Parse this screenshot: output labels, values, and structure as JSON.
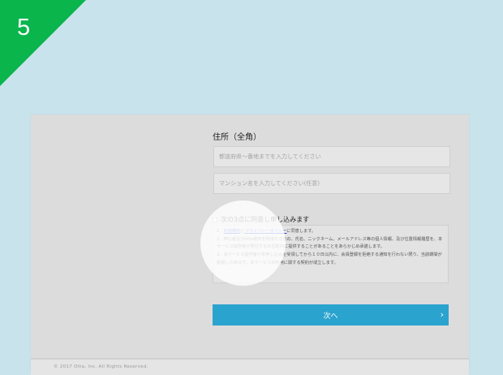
{
  "step": {
    "number": "5"
  },
  "form": {
    "address_title": "住所（全角）",
    "address_line1_placeholder": "都道府県〜番地までを入力してください",
    "address_line2_placeholder": "マンション名を入力してください(任意)",
    "agree_label": "次の3点に同意し申し込みます",
    "terms": {
      "item1_prefix": "1、",
      "item1_link1": "利用規約",
      "item1_sep": "と",
      "item1_link2": "プライバシーポリシー",
      "item1_suffix": "に同意します。",
      "item2": "2、申込者及びotta端末を所持する方の、氏名、ニックネーム、メールアドレス等の個人情報、及び位置情報履歴を、本サービス提供者が居住する市区町村に提供することがあることをあらかじめ承諾します。",
      "item3": "3、本サービス提供者が本申し込みを受領してから１０日以内に、会員登録を拒絶する通知を行わない限り、当該期間が経過した時点で、本サービスの利用に関する契約が成立します。"
    },
    "next_label": "次へ",
    "next_chevron": "›"
  },
  "footer": {
    "copyright": "© 2017 Otta, Inc. All Rights Reserved."
  },
  "colors": {
    "accent": "#2aa3cf",
    "step_badge": "#0ab54c",
    "background": "#c9e3ec"
  }
}
